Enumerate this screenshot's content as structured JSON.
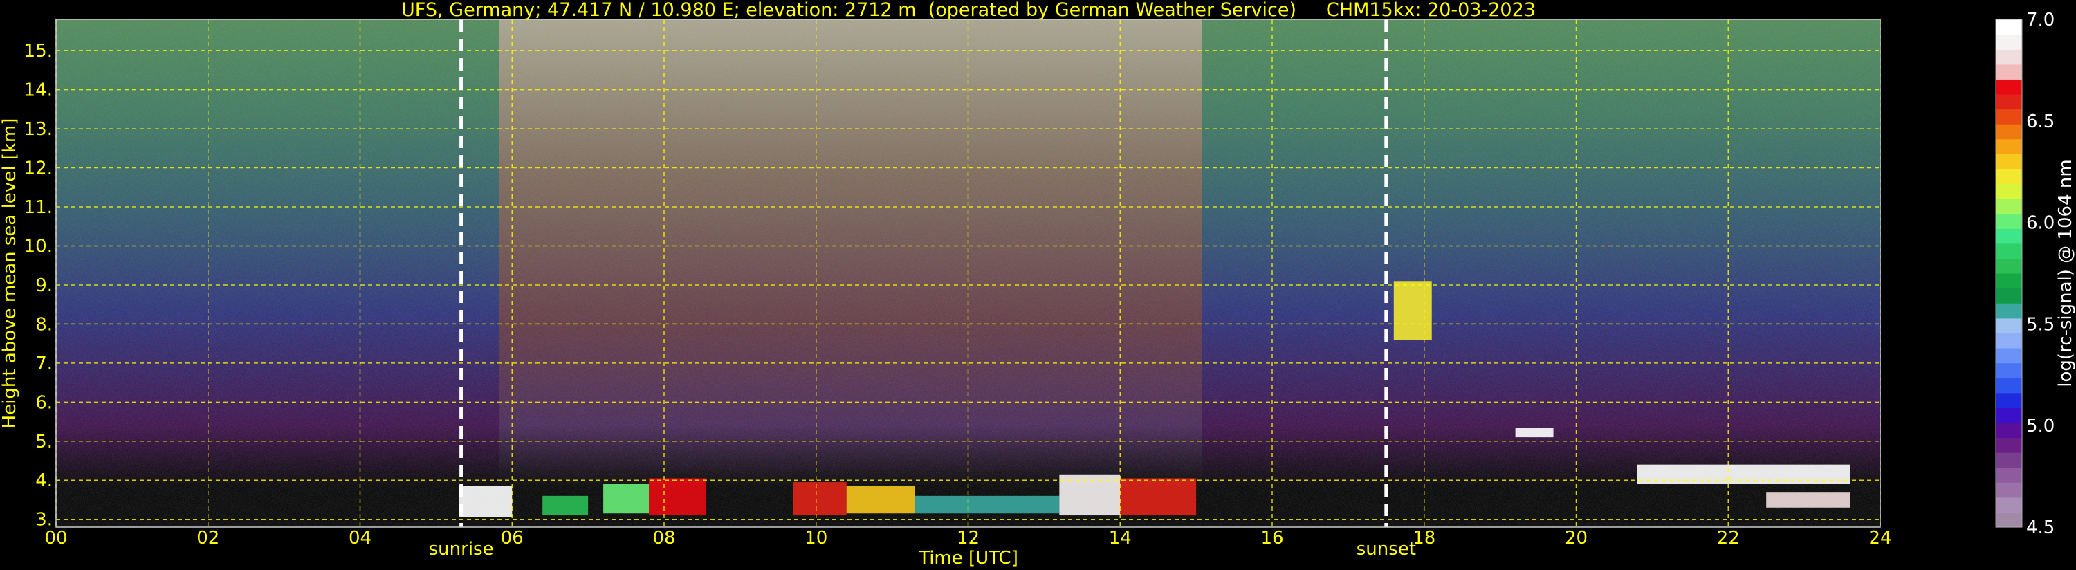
{
  "chart_data": {
    "type": "heatmap",
    "title": "UFS, Germany; 47.417 N / 10.980 E; elevation: 2712 m  (operated by German Weather Service)     CHM15kx: 20-03-2023",
    "xlabel": "Time [UTC]",
    "ylabel": "Height above mean sea level [km]",
    "xlim": [
      0,
      24
    ],
    "ylim": [
      2.8,
      15.8
    ],
    "x_ticks": [
      "00",
      "02",
      "04",
      "06",
      "08",
      "10",
      "12",
      "14",
      "16",
      "18",
      "20",
      "22",
      "24"
    ],
    "y_ticks": [
      "3.",
      "4.",
      "5.",
      "6.",
      "7.",
      "8.",
      "9.",
      "10.",
      "11.",
      "12.",
      "13.",
      "14.",
      "15."
    ],
    "grid": true,
    "markers": [
      {
        "label": "sunrise",
        "time": 5.33
      },
      {
        "label": "sunset",
        "time": 17.5
      }
    ],
    "colorbar": {
      "label": "log(rc-signal) @ 1064 nm",
      "range": [
        4.5,
        7.0
      ],
      "ticks": [
        "4.5",
        "5.0",
        "5.5",
        "6.0",
        "6.5",
        "7.0"
      ],
      "colors": [
        "#a08aa8",
        "#a98fb6",
        "#9a72a8",
        "#8e5c9e",
        "#7a3e8e",
        "#6a1f86",
        "#5a0f9c",
        "#3a10c8",
        "#1f2bdf",
        "#2f55ef",
        "#4b74f5",
        "#6b93f7",
        "#8fb0f8",
        "#9fc2f0",
        "#3aa8a0",
        "#139a48",
        "#16a845",
        "#2bbf55",
        "#2fd06a",
        "#3ee68a",
        "#68ef78",
        "#a4f45a",
        "#d8f53c",
        "#f3e830",
        "#f7c81e",
        "#f6a416",
        "#f07a10",
        "#ea4a12",
        "#e02418",
        "#e80a12",
        "#f2baba",
        "#f0dede",
        "#f7f2f2",
        "#ffffff"
      ]
    },
    "clouds": [
      {
        "t0": 5.3,
        "t1": 6.0,
        "h0": 3.05,
        "h1": 3.85,
        "level": 7.0
      },
      {
        "t0": 6.4,
        "t1": 7.0,
        "h0": 3.1,
        "h1": 3.6,
        "level": 5.8
      },
      {
        "t0": 7.2,
        "t1": 7.8,
        "h0": 3.15,
        "h1": 3.9,
        "level": 6.0
      },
      {
        "t0": 7.8,
        "t1": 8.55,
        "h0": 3.1,
        "h1": 4.05,
        "level": 6.7
      },
      {
        "t0": 9.7,
        "t1": 10.4,
        "h0": 3.1,
        "h1": 3.95,
        "level": 6.6
      },
      {
        "t0": 10.4,
        "t1": 11.3,
        "h0": 3.15,
        "h1": 3.85,
        "level": 6.3
      },
      {
        "t0": 11.3,
        "t1": 13.2,
        "h0": 3.15,
        "h1": 3.6,
        "level": 5.6
      },
      {
        "t0": 13.2,
        "t1": 14.0,
        "h0": 3.1,
        "h1": 4.15,
        "level": 6.9
      },
      {
        "t0": 14.0,
        "t1": 15.0,
        "h0": 3.1,
        "h1": 4.05,
        "level": 6.6
      },
      {
        "t0": 17.6,
        "t1": 18.1,
        "h0": 7.6,
        "h1": 9.1,
        "level": 6.2
      },
      {
        "t0": 19.2,
        "t1": 19.7,
        "h0": 5.1,
        "h1": 5.35,
        "level": 7.0
      },
      {
        "t0": 20.8,
        "t1": 23.6,
        "h0": 3.9,
        "h1": 4.4,
        "level": 7.0
      },
      {
        "t0": 22.5,
        "t1": 23.6,
        "h0": 3.3,
        "h1": 3.7,
        "level": 6.8
      }
    ]
  }
}
